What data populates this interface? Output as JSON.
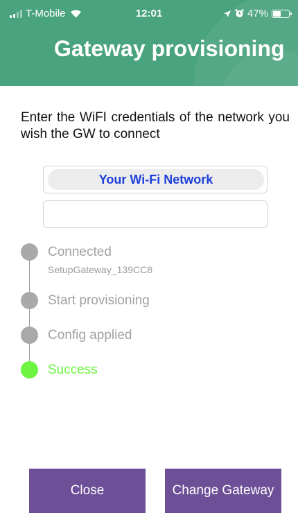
{
  "status_bar": {
    "carrier": "T-Mobile",
    "time": "12:01",
    "battery": "47%",
    "battery_level": 0.47,
    "icons": [
      "signal-icon",
      "wifi-icon",
      "location-arrow-icon",
      "alarm-clock-icon",
      "battery-icon"
    ]
  },
  "header": {
    "title": "Gateway provisioning",
    "color": "#4aa37f"
  },
  "instructions": "Enter the WiFI credentials of the network you wish the GW to connect",
  "form": {
    "ssid_value": "Your Wi-Fi Network",
    "password_value": ""
  },
  "steps": [
    {
      "label": "Connected",
      "sub": "SetupGateway_139CC8",
      "state": "done"
    },
    {
      "label": "Start provisioning",
      "state": "done"
    },
    {
      "label": "Config applied",
      "state": "done"
    },
    {
      "label": "Success",
      "state": "success"
    }
  ],
  "colors": {
    "step_inactive": "#a9a9a9",
    "step_success": "#6df542",
    "button": "#6c4f96",
    "ssid_text": "#1d3fdb"
  },
  "buttons": {
    "close_label": "Close",
    "change_label": "Change Gateway"
  }
}
